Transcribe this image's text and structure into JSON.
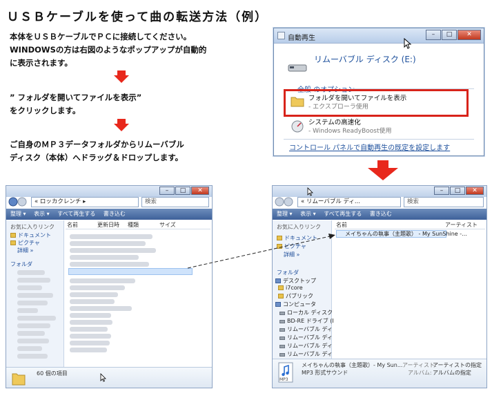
{
  "title": "ＵＳＢケーブルを使って曲の転送方法（例）",
  "steps": {
    "s1_line1": "本体をＵＳＢケーブルでＰＣに接続してください。",
    "s1_line2": "WINDOWSの方は右図のようなポップアップが自動的",
    "s1_line3": "に表示されます。",
    "s2_line1": "” フォルダを開いてファイルを表示”",
    "s2_line2": "をクリックします。",
    "s3_line1": "ご自身のＭＰ３データフォルダからリムーバブル",
    "s3_line2": "ディスク（本体）へドラッグ＆ドロップします。"
  },
  "colors": {
    "accent_red": "#e8281c",
    "link_blue": "#1c4f9c"
  },
  "autoplay": {
    "window_title": "自動再生",
    "drive_name": "リムーバブル ディスク (E:)",
    "general_options": "全般 のオプション",
    "option1_title": "フォルダを開いてファイルを表示",
    "option1_sub": "- エクスプローラ使用",
    "option2_title": "システムの高速化",
    "option2_sub": "- Windows ReadyBoost使用",
    "control_link": "コントロール パネルで自動再生の既定を設定します"
  },
  "explorer_left": {
    "address": "« ロッカクレンチ ▸",
    "search": "検索",
    "toolbar": [
      "整理 ▾",
      "表示 ▾",
      "すべて再生する",
      "書き込む"
    ],
    "favorites": "お気に入りリンク",
    "documents": "ドキュメント",
    "pictures": "ピクチャ",
    "more": "詳細 »",
    "folders": "フォルダ",
    "columns": [
      "名前",
      "更新日時",
      "種類",
      "サイズ"
    ],
    "status": "60 個の項目"
  },
  "explorer_right": {
    "address": "« リムーバブル ディ...",
    "search": "検索",
    "toolbar": [
      "整理 ▾",
      "表示 ▾",
      "すべて再生する",
      "書き込む"
    ],
    "favorites": "お気に入りリンク",
    "documents": "ドキュメント",
    "pictures": "ピクチャ",
    "more": "詳細 »",
    "folders": "フォルダ",
    "columns": [
      "名前",
      "アーティスト"
    ],
    "file": "メイちゃんの執事（主題歌） - My SunShine -...",
    "tree": [
      "デスクトップ",
      "i7core",
      "パブリック",
      "コンピュータ",
      "ローカル ディスク",
      "BD-RE ドライブ (I",
      "リムーバブル ディ",
      "リムーバブル ディ",
      "リムーバブル ディ",
      "リムーバブル ディ"
    ],
    "details_name": "メイちゃんの執事（主題歌）- My Sun...",
    "details_type": "MP3 形式サウンド",
    "artist_label": "アーティスト:",
    "artist_value": "アーティストの指定",
    "album_label": "アルバム:",
    "album_value": "アルバムの指定",
    "mp3_badge": "MP3"
  }
}
